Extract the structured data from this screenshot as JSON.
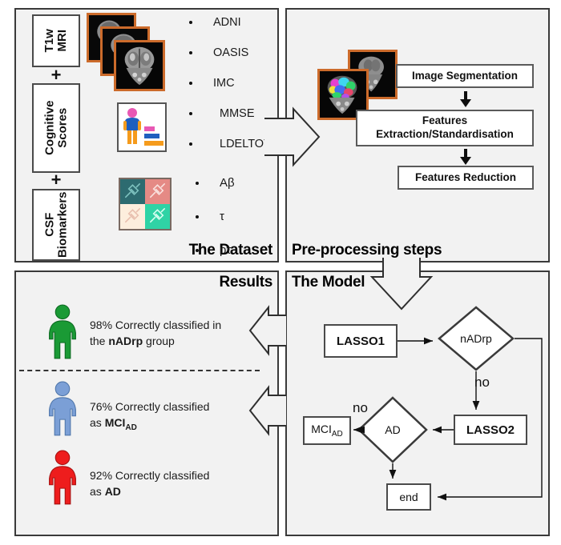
{
  "figure": {
    "panels": {
      "dataset": {
        "title": "The Dataset",
        "groups": [
          {
            "label": "T1w\nMRI",
            "label_line1": "T1w",
            "label_line2": "MRI"
          },
          {
            "label_line1": "Cognitive",
            "label_line2": "Scores"
          },
          {
            "label_line1": "CSF",
            "label_line2": "Biomarkers"
          }
        ],
        "plus_symbol": "+",
        "data_bullets": [
          "ADNI",
          "OASIS",
          "IMC",
          "MMSE",
          "LDELTOTAL"
        ],
        "csf_bullets": [
          "Aβ",
          "τ",
          "pτ"
        ],
        "icons": {
          "mri_stack": "mri-brain-stack-icon",
          "cognitive": "cognitive-scores-person-chart-icon",
          "csf": "csf-syringe-grid-icon"
        }
      },
      "preprocessing": {
        "title": "Pre-processing steps",
        "steps": [
          {
            "label": "Image Segmentation"
          },
          {
            "label_line1": "Features",
            "label_line2": "Extraction/Standardisation"
          },
          {
            "label": "Features Reduction"
          }
        ],
        "icon": "segmented-brain-overlay-icon"
      },
      "results": {
        "title": "Results",
        "items": [
          {
            "color": "#1a9a35",
            "text_prefix": "98% Correctly classified in",
            "text_line2_pre": "the ",
            "text_line2_bold": "nADrp",
            "text_line2_post": " group",
            "percent": "98%",
            "group": "nADrp"
          },
          {
            "color": "#7b9fd6",
            "text_prefix": "76% Correctly classified",
            "text_line2_pre": "as ",
            "text_line2_bold": "MCI",
            "text_line2_sub": "AD",
            "text_line2_post": "",
            "percent": "76%",
            "group": "MCI_AD"
          },
          {
            "color": "#ee1d1d",
            "text_prefix": "92% Correctly classified",
            "text_line2_pre": "as ",
            "text_line2_bold": "AD",
            "text_line2_post": "",
            "percent": "92%",
            "group": "AD"
          }
        ]
      },
      "model": {
        "title": "The Model",
        "nodes": {
          "lasso1": "LASSO1",
          "lasso2": "LASSO2",
          "nadrp": "nADrp",
          "ad": "AD",
          "mci_main": "MCI",
          "mci_sub": "AD",
          "end": "end"
        },
        "edge_labels": {
          "no_1": "no",
          "no_2": "no"
        }
      }
    },
    "colors": {
      "panel_bg": "#f2f2f2",
      "panel_border": "#3a3a3a",
      "mri_border": "#cc6b2b",
      "green": "#1a9a35",
      "blue": "#7b9fd6",
      "red": "#ee1d1d",
      "csf_teal": "#2d6b70",
      "csf_salmon": "#e58a85",
      "csf_cream": "#fdeedd",
      "csf_mint": "#2fd3a5",
      "cog_pink": "#e858b4",
      "cog_blue": "#1f5fbf",
      "cog_orange": "#f59b1c"
    }
  }
}
